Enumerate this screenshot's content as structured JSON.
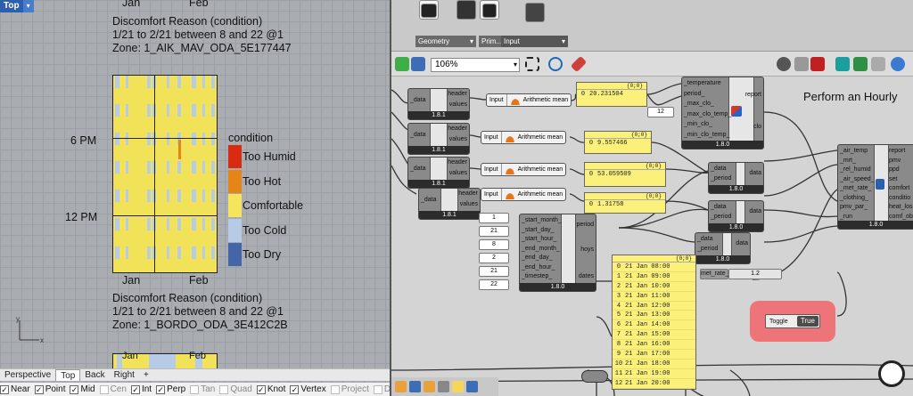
{
  "rhino": {
    "viewport_name": "Top",
    "chart_top": {
      "month_labels_top": [
        "Jan",
        "Feb"
      ],
      "title": "Discomfort Reason (condition)",
      "period": "1/21 to 2/21 between 8 and 22 @1",
      "zone": "Zone: 1_AIK_MAV_ODA_5E177447",
      "y_labels": [
        "6 PM",
        "12 PM"
      ],
      "month_labels_bottom": [
        "Jan",
        "Feb"
      ]
    },
    "chart_bottom": {
      "title": "Discomfort Reason (condition)",
      "period": "1/21 to 2/21 between 8 and 22 @1",
      "zone": "Zone: 1_BORDO_ODA_3E412C2B",
      "month_labels_top": [
        "Jan",
        "Feb"
      ]
    },
    "legend": {
      "title": "condition",
      "items": [
        {
          "label": "Too Humid",
          "color": "#d92b12"
        },
        {
          "label": "Too Hot",
          "color": "#e58417"
        },
        {
          "label": "Comfortable",
          "color": "#f4e55c"
        },
        {
          "label": "Too Cold",
          "color": "#b6cbe6"
        },
        {
          "label": "Too Dry",
          "color": "#4466a9"
        }
      ]
    },
    "axis_labels": [
      "y",
      "x"
    ],
    "view_tabs": [
      "Perspective",
      "Top",
      "Back",
      "Right",
      "+"
    ],
    "snaps": [
      {
        "label": "Near",
        "on": true
      },
      {
        "label": "Point",
        "on": true
      },
      {
        "label": "Mid",
        "on": true
      },
      {
        "label": "Cen",
        "on": false
      },
      {
        "label": "Int",
        "on": true
      },
      {
        "label": "Perp",
        "on": true
      },
      {
        "label": "Tan",
        "on": false
      },
      {
        "label": "Quad",
        "on": false
      },
      {
        "label": "Knot",
        "on": true
      },
      {
        "label": "Vertex",
        "on": true
      },
      {
        "label": "Project",
        "on": false
      },
      {
        "label": "Disable",
        "on": false
      }
    ]
  },
  "grasshopper": {
    "ribbon_groups": [
      "Geometry",
      "Prim...",
      "Input"
    ],
    "zoom_level": "106%",
    "canvas_title": "Perform an Hourly",
    "header_values_inputs": [
      {
        "left": "_data",
        "outputs": [
          "header",
          "values"
        ],
        "version": "1.8.1"
      },
      {
        "left": "_data",
        "outputs": [
          "header",
          "values"
        ],
        "version": "1.8.1"
      },
      {
        "left": "_data",
        "outputs": [
          "header",
          "values"
        ],
        "version": "1.8.1"
      },
      {
        "left": "_data",
        "outputs": [
          "header",
          "values"
        ],
        "version": "1.8.1"
      }
    ],
    "mean_components": [
      {
        "input": "Input",
        "name": "Arithmetic mean"
      },
      {
        "input": "Input",
        "name": "Arithmetic mean"
      },
      {
        "input": "Input",
        "name": "Arithmetic mean"
      },
      {
        "input": "Input",
        "name": "Arithmetic mean"
      }
    ],
    "mean_panels": [
      {
        "path": "{0;0}",
        "index": "0",
        "value": "20.231504"
      },
      {
        "path": "{0;0}",
        "index": "0",
        "value": "9.557466"
      },
      {
        "path": "{0;0}",
        "index": "0",
        "value": "53.059509"
      },
      {
        "path": "{0;0}",
        "index": "0",
        "value": "1.31758"
      }
    ],
    "clothing": {
      "inputs": [
        "_temperature",
        "period_",
        "_max_clo_",
        "_max_clo_temp_",
        "_min_clo_",
        "_min_clo_temp_"
      ],
      "outputs": [
        "report",
        "clo"
      ],
      "version": "1.8.0",
      "slider_value": "12"
    },
    "apply_period": [
      {
        "inputs": [
          "_data",
          "_period"
        ],
        "output": "data",
        "version": "1.8.0"
      },
      {
        "inputs": [
          "_data",
          "_period"
        ],
        "output": "data",
        "version": "1.8.0"
      },
      {
        "inputs": [
          "_data",
          "_period"
        ],
        "output": "data",
        "version": "1.8.0"
      }
    ],
    "analysis_period": {
      "inputs": [
        "_start_month_",
        "_start_day_",
        "_start_hour_",
        "_end_month_",
        "_end_day_",
        "_end_hour_",
        "_timestep_"
      ],
      "outputs": [
        "period",
        "hoys",
        "dates"
      ],
      "values": [
        "1",
        "21",
        "8",
        "2",
        "21",
        "22"
      ],
      "version": "1.8.0"
    },
    "pmv": {
      "inputs": [
        "_air_temp",
        "_mrt_",
        "_rel_humid",
        "_air_speed_",
        "_met_rate_",
        "_clothing_",
        "pmv_par_",
        "_run"
      ],
      "outputs": [
        "report",
        "pmv",
        "ppd",
        "set",
        "comfort",
        "conditio",
        "heat_los",
        "comf_ob"
      ],
      "version": "1.8.0"
    },
    "met_rate": {
      "label": "met_rate_",
      "value": "1.2"
    },
    "dates_panel": {
      "path": "{0;0}",
      "rows": [
        {
          "i": "0",
          "v": "21 Jan 08:00"
        },
        {
          "i": "1",
          "v": "21 Jan 09:00"
        },
        {
          "i": "2",
          "v": "21 Jan 10:00"
        },
        {
          "i": "3",
          "v": "21 Jan 11:00"
        },
        {
          "i": "4",
          "v": "21 Jan 12:00"
        },
        {
          "i": "5",
          "v": "21 Jan 13:00"
        },
        {
          "i": "6",
          "v": "21 Jan 14:00"
        },
        {
          "i": "7",
          "v": "21 Jan 15:00"
        },
        {
          "i": "8",
          "v": "21 Jan 16:00"
        },
        {
          "i": "9",
          "v": "21 Jan 17:00"
        },
        {
          "i": "10",
          "v": "21 Jan 18:00"
        },
        {
          "i": "11",
          "v": "21 Jan 19:00"
        },
        {
          "i": "12",
          "v": "21 Jan 20:00"
        }
      ]
    },
    "toggle": {
      "label": "Toggle",
      "value": "True"
    }
  }
}
